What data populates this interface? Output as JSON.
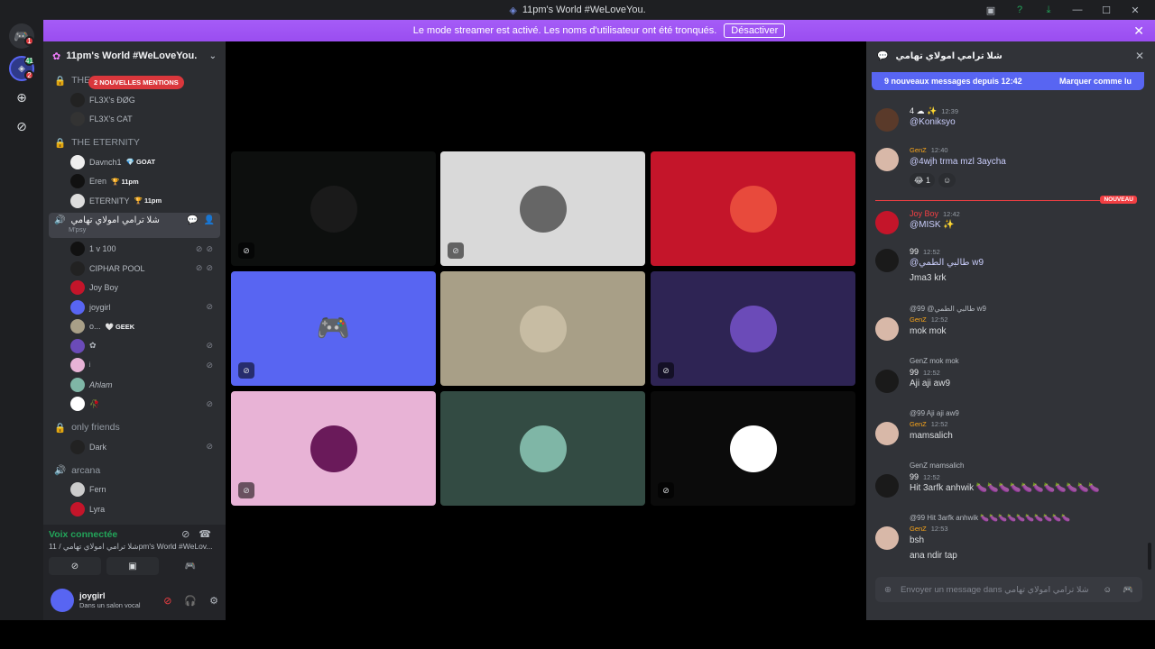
{
  "titlebar": {
    "title": "11pm's World #WeLoveYou."
  },
  "banner": {
    "text": "Le mode streamer est activé. Les noms d'utilisateur ont été tronqués.",
    "button": "Désactiver"
  },
  "rail": {
    "badge1": "1",
    "badge2": "2",
    "badge3": "41"
  },
  "server": {
    "name": "11pm's World #WeLoveYou."
  },
  "sidebar": {
    "mentions_pill": "2 NOUVELLES MENTIONS",
    "cat1": "THE NEXT",
    "cat1_users": [
      "FL3X's ÐØG",
      "FL3X's CAT"
    ],
    "cat2": "THE ETERNITY",
    "cat2_users": [
      {
        "name": "Davnch1",
        "tag": "💎 GOAT"
      },
      {
        "name": "Eren",
        "tag": "🏆 11pm"
      },
      {
        "name": "ETERNITY",
        "tag": "🏆 11pm"
      }
    ],
    "active_channel": "شلا ترامي امولاي تهامي",
    "active_sub": "M'psy",
    "active_users": [
      {
        "name": "1 v 100"
      },
      {
        "name": "CIPHAR POOL"
      },
      {
        "name": "Joy Boy"
      },
      {
        "name": "joygirl"
      },
      {
        "name": "o...",
        "tag": "🤍 GEEK"
      },
      {
        "name": "✿"
      },
      {
        "name": "ʲ"
      },
      {
        "name": "Ahlam"
      },
      {
        "name": "🥀"
      }
    ],
    "cat3": "only friends",
    "cat3_users": [
      "Dark"
    ],
    "cat4": "arcana",
    "cat4_users": [
      "Fern",
      "Lyra"
    ]
  },
  "voice": {
    "status": "Voix connectée",
    "location": "شلا ترامي امولاي تهامي / 11pm's World #WeLov..."
  },
  "user": {
    "name": "joygirl",
    "status": "Dans un salon vocal"
  },
  "stage": {
    "tiles": [
      {
        "bg": "#0d0f0e",
        "pic": "#1a1a1a"
      },
      {
        "bg": "#d9d9d9",
        "pic": "#666"
      },
      {
        "bg": "#c4152a",
        "pic": "#e84a3c"
      },
      {
        "bg": "#5865f2",
        "pic": "discord"
      },
      {
        "bg": "#a89f87",
        "pic": "#c7bca3"
      },
      {
        "bg": "#2e2454",
        "pic": "#6b4bb8"
      },
      {
        "bg": "#e8b3d6",
        "pic": "#6a1a5a"
      },
      {
        "bg": "#334b43",
        "pic": "#7fb6a6"
      },
      {
        "bg": "#0b0b0b",
        "pic": "#ffffff"
      }
    ]
  },
  "chat": {
    "header": "شلا ترامي امولاي تهامي",
    "new_banner": "9 nouveaux messages depuis 12:42",
    "mark_read": "Marquer comme lu",
    "new_label": "NOUVEAU",
    "messages": [
      {
        "author": "4 ☁ ✨",
        "time": "12:39",
        "text": "@Koniksyo"
      },
      {
        "author": "GenZ",
        "time": "12:40",
        "text": "@4wjh trma mzl 3aycha",
        "reaction": "😂 1"
      },
      {
        "author": "Joy Boy",
        "time": "12:42",
        "text": "@MISK ✨"
      },
      {
        "author": "99",
        "time": "12:52",
        "text": "@طالبي الطمي w9",
        "text2": "Jma3 krk"
      },
      {
        "reply": "@99 @طالبي الطمي w9",
        "author": "GenZ",
        "time": "12:52",
        "text": "mok mok"
      },
      {
        "reply": "GenZ mok mok",
        "author": "99",
        "time": "12:52",
        "text": "Aji aji aw9"
      },
      {
        "reply": "@99 Aji aji aw9",
        "author": "GenZ",
        "time": "12:52",
        "text": "mamsalich"
      },
      {
        "reply": "GenZ mamsalich",
        "author": "99",
        "time": "12:52",
        "text": "Hit 3arfk anhwik 🍆🍆🍆🍆🍆🍆🍆🍆🍆🍆🍆"
      },
      {
        "reply": "@99 Hit 3arfk anhwik 🍆🍆🍆🍆🍆🍆🍆🍆🍆🍆",
        "author": "GenZ",
        "time": "12:53",
        "text": "bsh",
        "text2": "ana ndir tap"
      }
    ],
    "input_placeholder": "Envoyer un message dans شلا ترامي امولاي تهامي"
  }
}
